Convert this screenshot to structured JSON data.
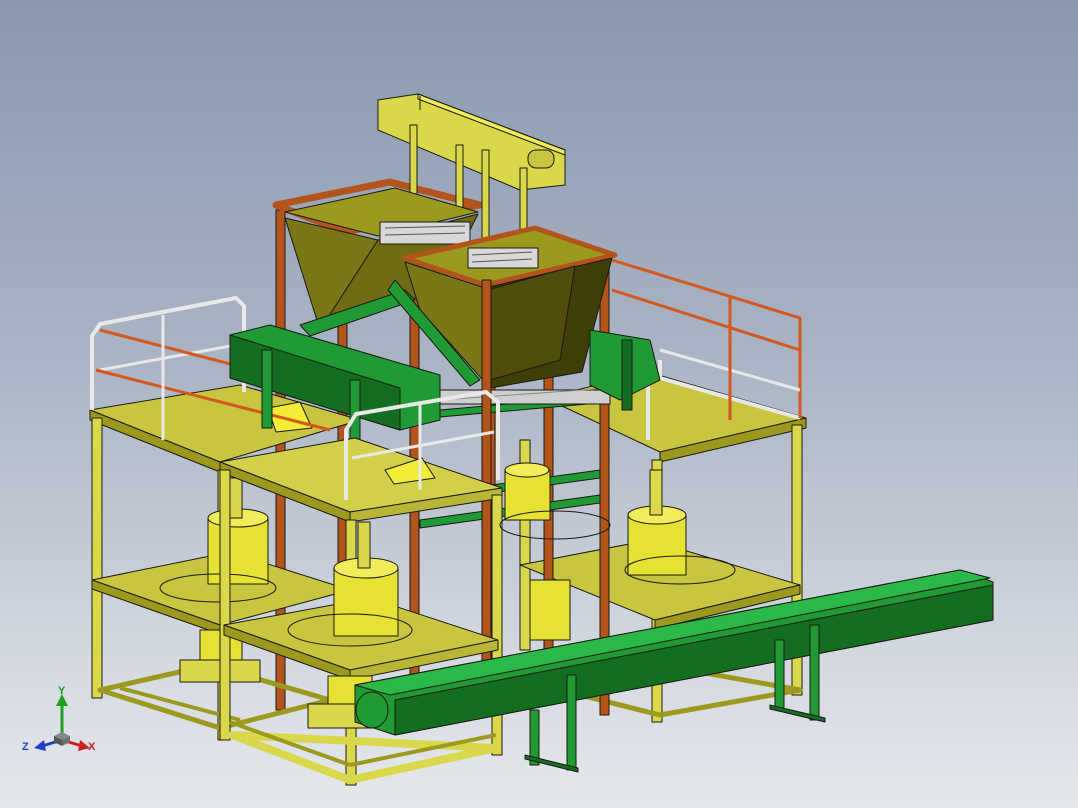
{
  "viewport": {
    "background_top": "#8a98ae",
    "background_bottom": "#e6e8ec"
  },
  "model": {
    "colors": {
      "frame_yellow": "#d9d84a",
      "frame_yellow_dark": "#9c9a1e",
      "deck_yellow": "#c8c640",
      "tank_yellow": "#e6e233",
      "hopper_olive": "#6f6c14",
      "hopper_olive_dark": "#3f3d08",
      "column_rust": "#b3541c",
      "rail_orange": "#d4571e",
      "rail_white": "#e8e8e8",
      "conveyor_green": "#1f9a35",
      "conveyor_green_dark": "#146e22",
      "edge": "#1a1a10"
    }
  },
  "triad": {
    "x_label": "X",
    "y_label": "Y",
    "z_label": "Z",
    "x_color": "#cc2020",
    "y_color": "#20a020",
    "z_color": "#2040c0"
  }
}
